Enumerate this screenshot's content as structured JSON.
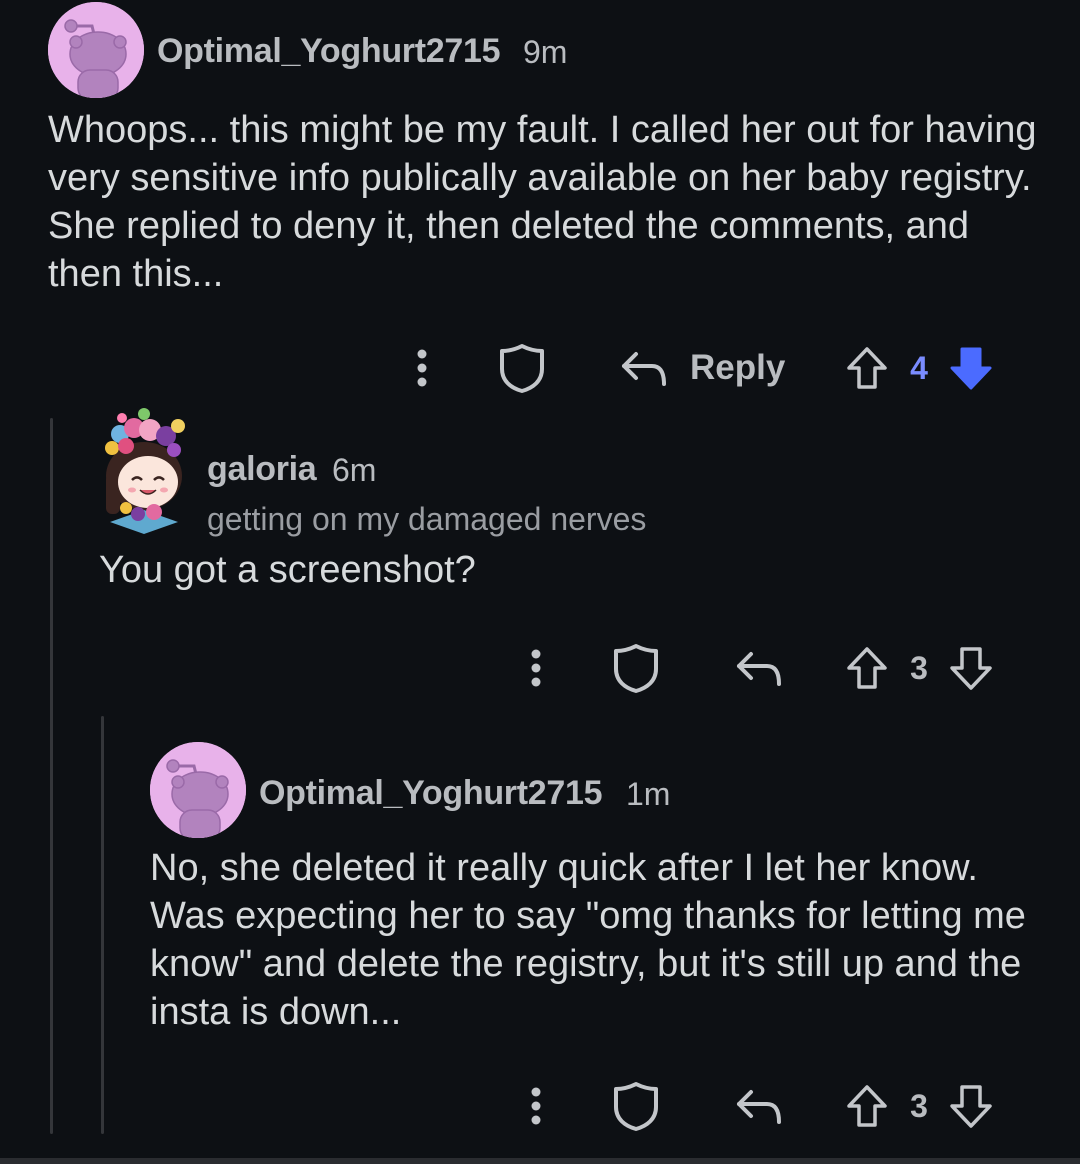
{
  "comments": [
    {
      "username": "Optimal_Yoghurt2715",
      "time": "9m",
      "body": "Whoops... this might be my fault. I called her out for having very sensitive info publically available on her baby registry. She replied to deny it, then deleted the comments, and then this...",
      "actions": {
        "more_icon": "more-vertical-icon",
        "award_icon": "shield-icon",
        "reply_icon": "reply-arrow-icon",
        "reply_label": "Reply",
        "upvote_icon": "upvote-arrow-icon",
        "score": "4",
        "downvote_icon": "downvote-arrow-icon",
        "downvoted": true
      }
    },
    {
      "username": "galoria",
      "time": "6m",
      "flair": "getting on my damaged nerves",
      "body": "You got a screenshot?",
      "actions": {
        "more_icon": "more-vertical-icon",
        "award_icon": "shield-icon",
        "reply_icon": "reply-arrow-icon",
        "upvote_icon": "upvote-arrow-icon",
        "score": "3",
        "downvote_icon": "downvote-arrow-icon"
      }
    },
    {
      "username": "Optimal_Yoghurt2715",
      "time": "1m",
      "body": "No, she deleted it really quick after I let her know. Was expecting her to say \"omg thanks for letting me know\" and delete the registry, but it's still up and the insta is down...",
      "actions": {
        "more_icon": "more-vertical-icon",
        "award_icon": "shield-icon",
        "reply_icon": "reply-arrow-icon",
        "upvote_icon": "upvote-arrow-icon",
        "score": "3",
        "downvote_icon": "downvote-arrow-icon"
      }
    }
  ],
  "colors": {
    "background": "#0d1014",
    "text": "#d7dadc",
    "meta": "#b9bcc0",
    "avatar": "#e8b2ea",
    "downvote_active": "#7a8cff"
  }
}
